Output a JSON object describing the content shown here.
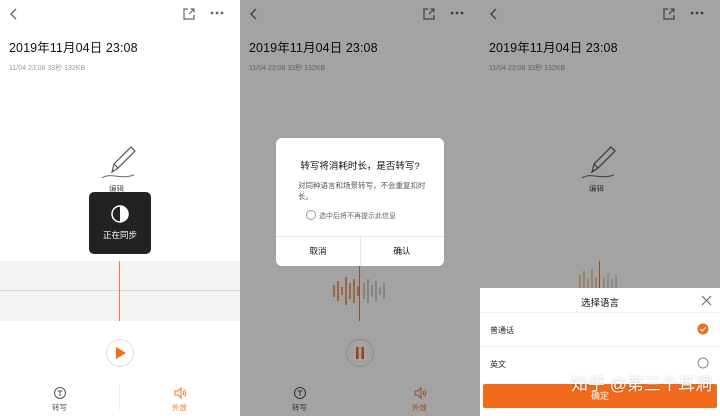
{
  "recording": {
    "title": "2019年11月04日 23:08",
    "meta": "11/04 23:08 33秒 132KB"
  },
  "panel1": {
    "edit_label": "编辑",
    "sync_toast": "正在同步",
    "bottom_left_label": "转写",
    "bottom_right_label": "外放"
  },
  "panel2": {
    "edit_label": "编辑",
    "dialog": {
      "title": "转写将消耗时长，是否转写?",
      "text": "对同种语言和场景转写，不会重复扣时长。",
      "checkbox_label": "选中后将不再提示此信息",
      "cancel": "取消",
      "confirm": "确认"
    },
    "bottom_left_label": "转写",
    "bottom_right_label": "外放"
  },
  "panel3": {
    "edit_label": "编辑",
    "sheet": {
      "title": "选择语言",
      "options": [
        {
          "label": "普通话",
          "selected": true
        },
        {
          "label": "英文",
          "selected": false
        }
      ],
      "confirm": "确定"
    }
  },
  "watermark": "知乎 @第三个耳洞",
  "colors": {
    "accent": "#f27b2e",
    "overlay": "rgba(0,0,0,0.36)",
    "button": "#f26a1b"
  },
  "icons": [
    "back-icon",
    "share-icon",
    "more-icon",
    "pen-icon",
    "sync-icon",
    "play-icon",
    "pause-icon",
    "transcribe-icon",
    "speaker-icon",
    "close-icon",
    "radio-selected-icon",
    "radio-empty-icon"
  ]
}
